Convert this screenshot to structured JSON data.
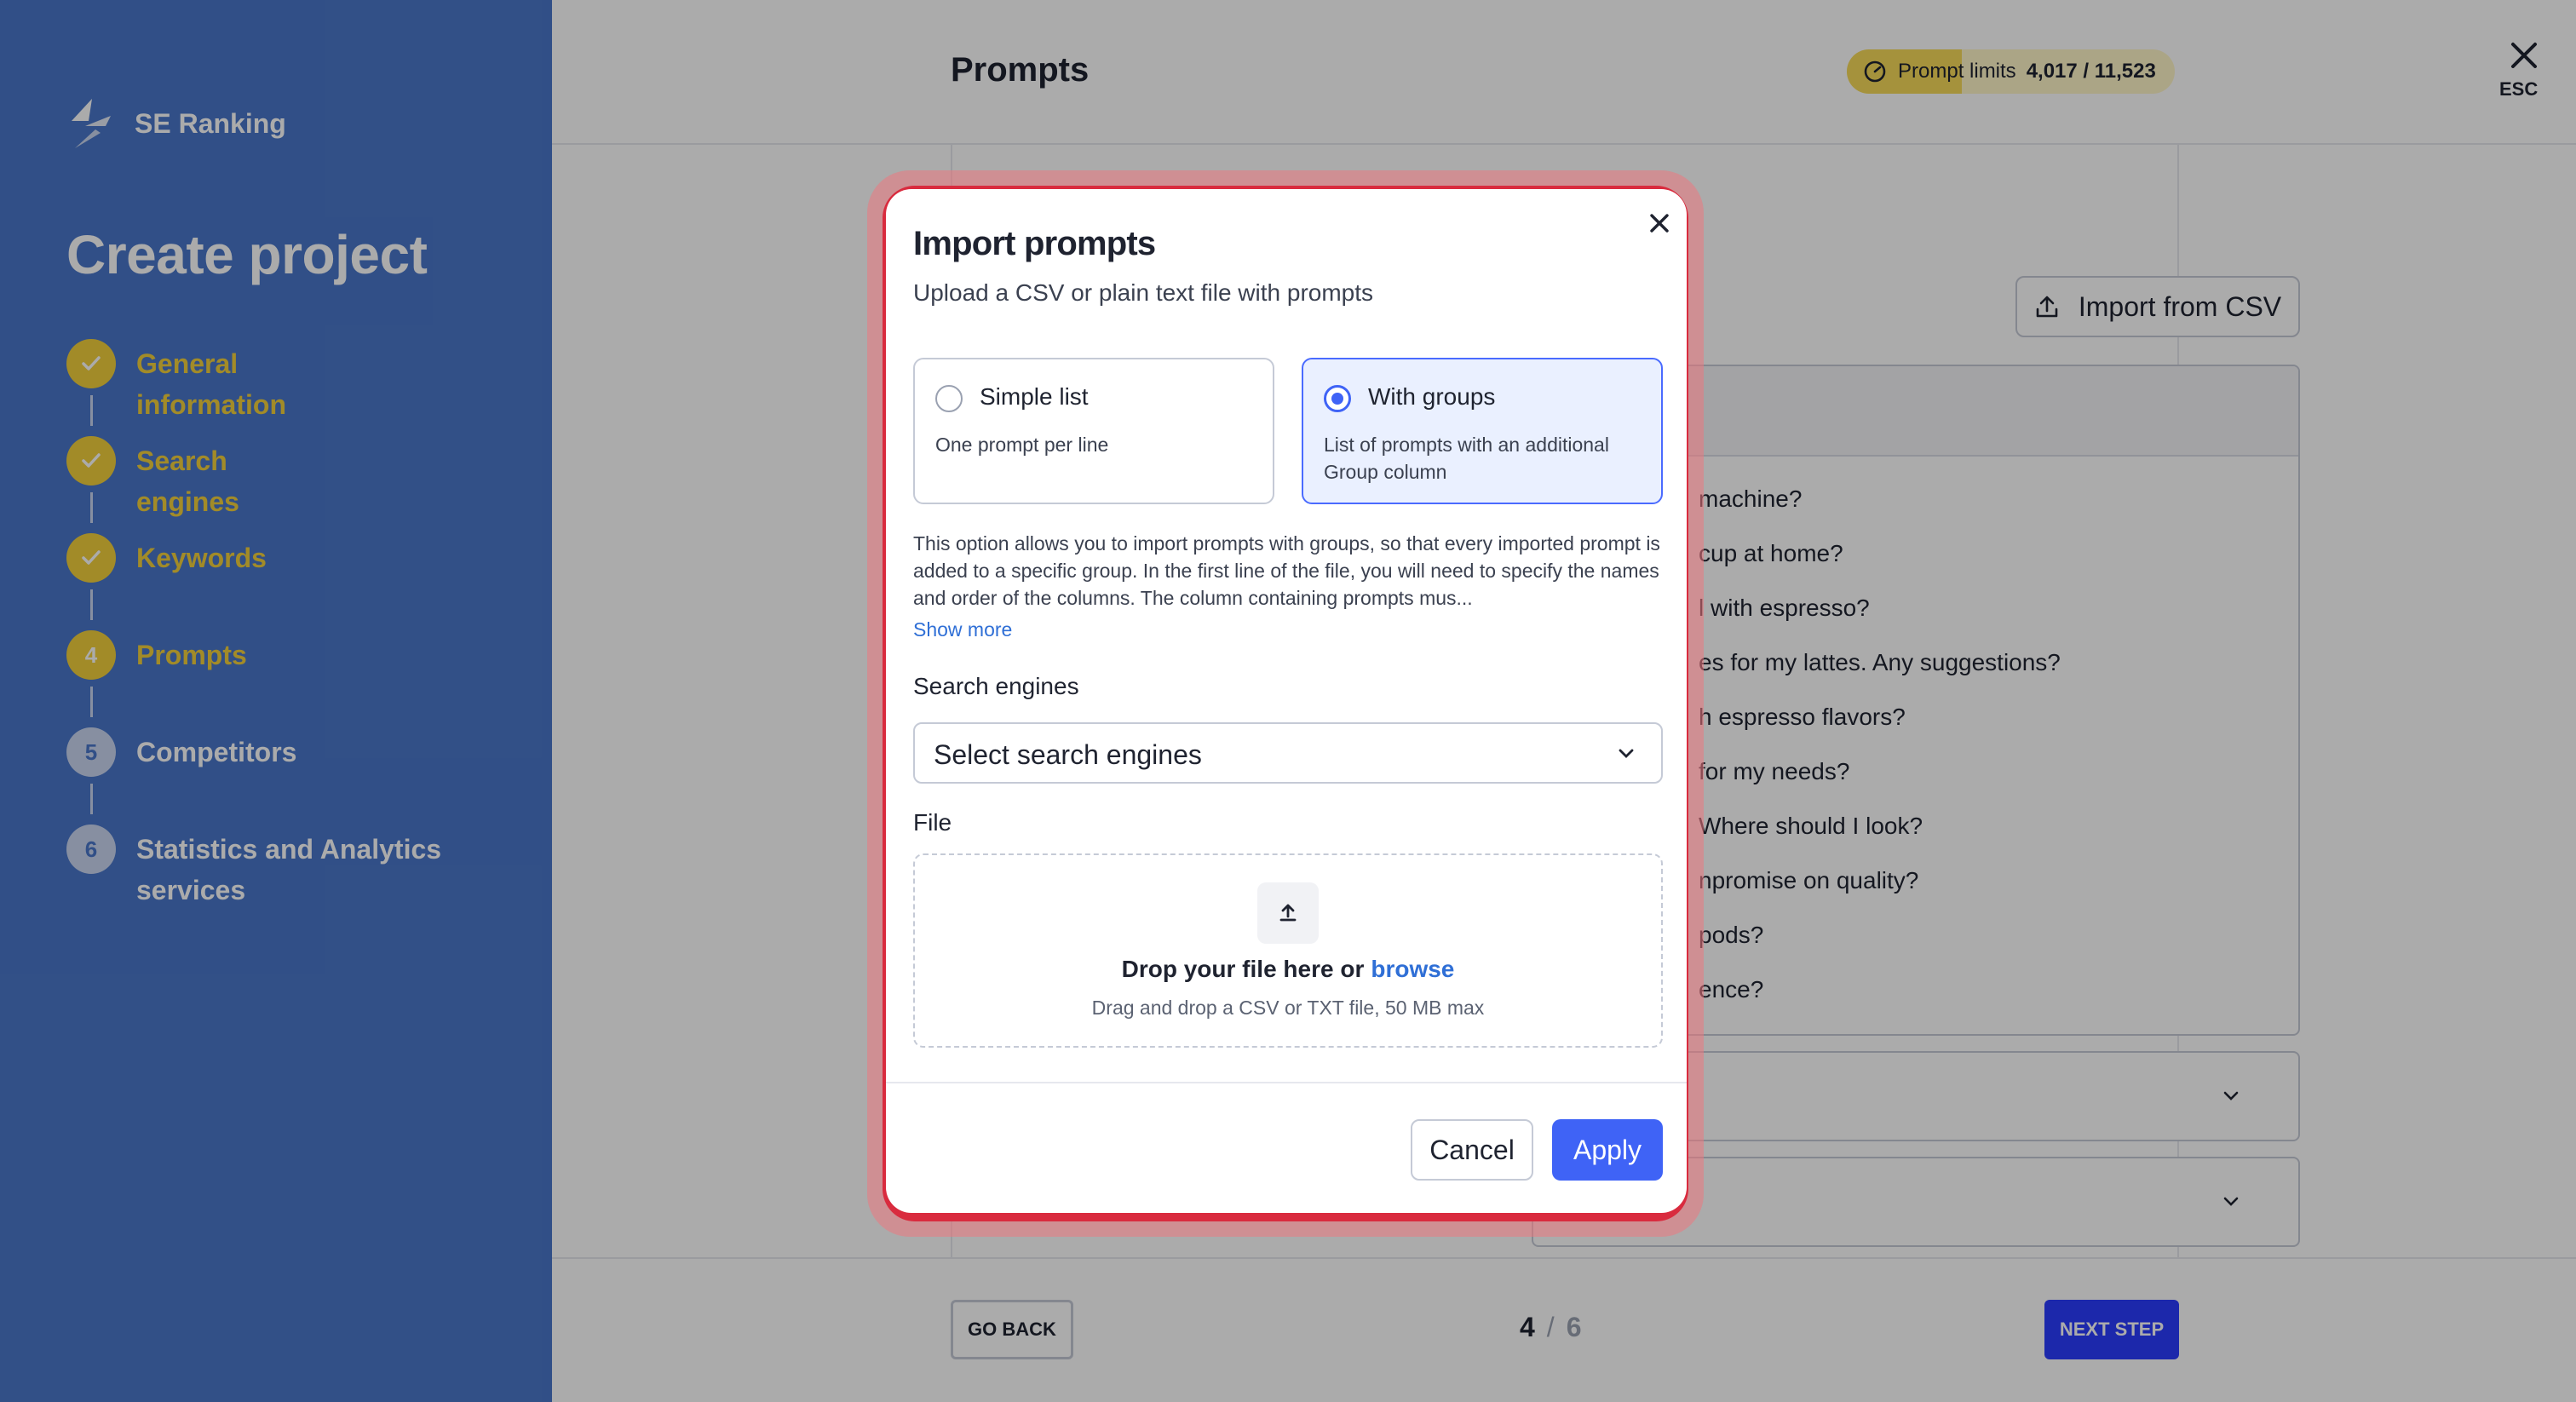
{
  "app": {
    "brand": "SE Ranking",
    "title": "Create project"
  },
  "steps": [
    {
      "num": "",
      "label": "General information",
      "state": "done"
    },
    {
      "num": "",
      "label": "Search engines",
      "state": "done"
    },
    {
      "num": "",
      "label": "Keywords",
      "state": "done"
    },
    {
      "num": "4",
      "label": "Prompts",
      "state": "current"
    },
    {
      "num": "5",
      "label": "Competitors",
      "state": "todo"
    },
    {
      "num": "6",
      "label": "Statistics and Analytics services",
      "state": "todo"
    }
  ],
  "header": {
    "title": "Prompts",
    "limits_label": "Prompt limits",
    "limits_value": "4,017 / 11,523",
    "limits_used_fraction": 0.35,
    "esc_label": "ESC"
  },
  "import_button": "Import from CSV",
  "prompt_items": [
    "machine?",
    "cup at home?",
    "l with espresso?",
    "es for my lattes. Any suggestions?",
    "h espresso flavors?",
    "for my needs?",
    "Where should I look?",
    "npromise on quality?",
    "pods?",
    "ence?"
  ],
  "footer": {
    "go_back": "GO BACK",
    "current": "4",
    "separator": "/",
    "total": "6",
    "next": "NEXT STEP"
  },
  "modal": {
    "title": "Import prompts",
    "subtitle": "Upload a CSV or plain text file with prompts",
    "options": [
      {
        "title": "Simple list",
        "desc": "One prompt per line",
        "selected": false
      },
      {
        "title": "With groups",
        "desc": "List of prompts with an additional Group column",
        "selected": true
      }
    ],
    "description": "This option allows you to import prompts with groups, so that every imported prompt is added to a specific group. In the first line of the file, you will need to specify the names and order of the columns. The column containing prompts mus...",
    "show_more": "Show more",
    "search_engines_label": "Search engines",
    "search_engines_value": "Select search engines",
    "file_label": "File",
    "drop_main": "Drop your file here or",
    "drop_browse": "browse",
    "drop_sub": "Drag and drop a CSV or TXT file, 50 MB max",
    "cancel": "Cancel",
    "apply": "Apply"
  },
  "colors": {
    "sidebar": "#4a77c9",
    "step_done": "#f2cf3c",
    "accent": "#3f63f6",
    "highlight": "#d92b3e",
    "next_step": "#2b3cff"
  }
}
